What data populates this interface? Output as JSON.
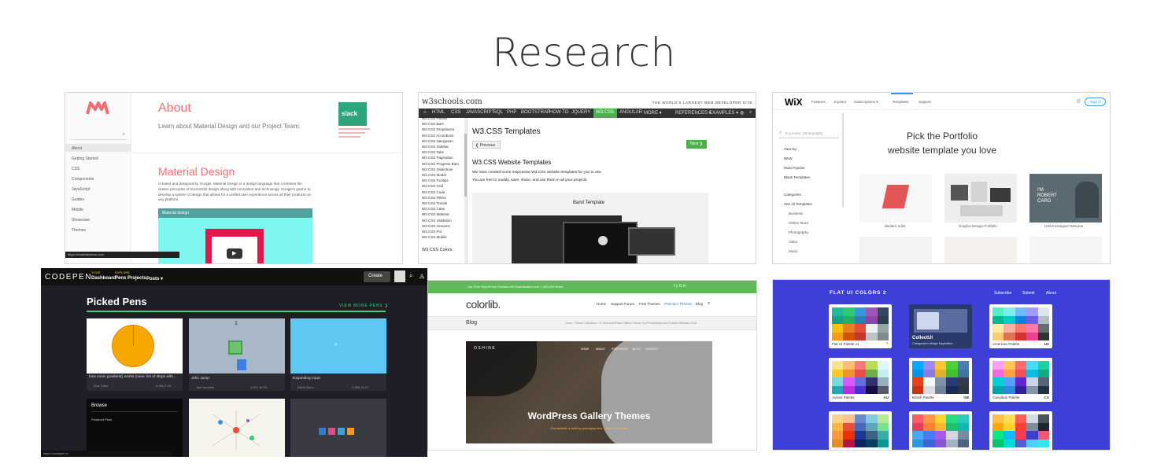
{
  "page": {
    "title": "Research"
  },
  "material": {
    "sidebar_items": [
      "About",
      "Getting Started",
      "CSS",
      "Components",
      "JavaScript",
      "Guides",
      "Mobile",
      "Showcase",
      "Themes"
    ],
    "section1_title": "About",
    "section1_text": "Learn about Material Design and our Project Team.",
    "section2_title": "Material Design",
    "section2_text": "Created and designed by Google, Material Design is a design language that combines the classic principles of successful design along with innovation and technology. Google's goal is to develop a system of design that allows for a unified user experience across all their products on any platform.",
    "video_title": "Material design",
    "slack_label": "slack",
    "status_url": "https://materializecss.com"
  },
  "w3": {
    "logo": "w3schools.com",
    "tagline": "THE WORLD'S LARGEST WEB DEVELOPER SITE",
    "nav": [
      "HTML",
      "CSS",
      "JAVASCRIPT",
      "SQL",
      "PHP",
      "BOOTSTRAP",
      "HOW TO",
      "JQUERY",
      "W3.CSS",
      "ANGULAR",
      "MORE ▾"
    ],
    "nav_right": [
      "REFERENCES ▾",
      "EXAMPLES ▾"
    ],
    "sidebar": [
      "W3.CSS Panels",
      "W3.CSS Bars",
      "W3.CSS Dropdowns",
      "W3.CSS Accordions",
      "W3.CSS Navigation",
      "W3.CSS Sidebar",
      "W3.CSS Tabs",
      "W3.CSS Pagination",
      "W3.CSS Progress Bars",
      "W3.CSS Slideshow",
      "W3.CSS Modal",
      "W3.CSS Tooltips",
      "W3.CSS Grid",
      "W3.CSS Code",
      "W3.CSS Filters",
      "W3.CSS Trends",
      "W3.CSS Case",
      "W3.CSS Material",
      "W3.CSS Validation",
      "W3.CSS Versions",
      "W3.CSS Pro",
      "W3.CSS Mobile"
    ],
    "sidebar_heading": "W3.CSS Colors",
    "page_title": "W3.CSS Templates",
    "prev": "❮ Previous",
    "next": "Next ❯",
    "section_title": "W3.CSS Website Templates",
    "p1": "We have created some responsive W3.CSS website templates for you to use.",
    "p2": "You are free to modify, save, share, and use them in all your projects.",
    "template_name": "Band Template"
  },
  "wix": {
    "logo": "WiX",
    "nav": [
      "Features",
      "Explore",
      "Subscriptions ▾",
      "Templates",
      "Support"
    ],
    "signin": "Sign In",
    "search_placeholder": "E.g music, photography",
    "view_by_label": "View by:",
    "view_by": [
      "NEW",
      "Most Popular",
      "Blank Templates"
    ],
    "categories_label": "Categories",
    "categories": [
      "See All Templates",
      "Business",
      "Online Store",
      "Photography",
      "Video",
      "Music"
    ],
    "heading_line1": "Pick the Portfolio",
    "heading_line2": "website template you love",
    "templates": [
      "Modern Artist",
      "Graphic Design Portfolio",
      "UX/UI Designer Resume"
    ],
    "resume_name": "I'M ROBERT CARO"
  },
  "codepen": {
    "logo": "CODEPEN",
    "your_label": "YOUR",
    "explore_label": "EXPLORE",
    "nav": [
      "Dashboard",
      "Pens",
      "Projects",
      "Posts ▾"
    ],
    "create": "Create",
    "heading": "Picked Pens",
    "view_more": "VIEW MORE PENS ❯",
    "pens": [
      {
        "title": "how conic-gradient() works (case: list of stops with...",
        "author": "Ana Tudor",
        "stats": "4,484  6  16"
      },
      {
        "title": "Jello Jump",
        "author": "Joel Kummel",
        "stats": "1,372  18  53"
      },
      {
        "title": "Expanding Input",
        "author": "Elliott Geno",
        "stats": "2,068  19  77"
      }
    ],
    "jello_number": "1",
    "browse": "Browse",
    "featured": "Featured Pens",
    "status_url": "https://codepen.io"
  },
  "colorlib": {
    "topbar": "Our Free WordPress Themes are Downloaded over 1,000,000 times.",
    "social": "f  y  G  in",
    "logo": "colorlib.",
    "nav": [
      "Home",
      "Support Forum",
      "Free Themes",
      "Premium Themes",
      "Blog",
      "⌕"
    ],
    "blog": "Blog",
    "breadcrumb": "Home › Theme Collections › 21 Best WordPress Gallery Themes For Photography And Portfolio Websites 2018",
    "hero_brand": "OSHINE",
    "hero_title": "WordPress Gallery Themes",
    "hero_sub": "Our website is built by photographers - with a lot of love",
    "hero_nav": [
      "HOME",
      "ABOUT",
      "PORTFOLIO",
      "BLOG",
      "CONTACT"
    ]
  },
  "flatui": {
    "title": "FLAT UI COLORS 2",
    "nav": [
      "Subscribe",
      "Submit",
      "About"
    ],
    "palettes": [
      {
        "name": "Flat UI Palette v1",
        "tag": ""
      },
      {
        "name": "CollectUI",
        "tag": "Categorized design inspiration."
      },
      {
        "name": "American Palette",
        "tag": "US"
      },
      {
        "name": "Aussie Palette",
        "tag": "AU"
      },
      {
        "name": "British Palette",
        "tag": "GB"
      },
      {
        "name": "Canadian Palette",
        "tag": "CA"
      }
    ]
  }
}
